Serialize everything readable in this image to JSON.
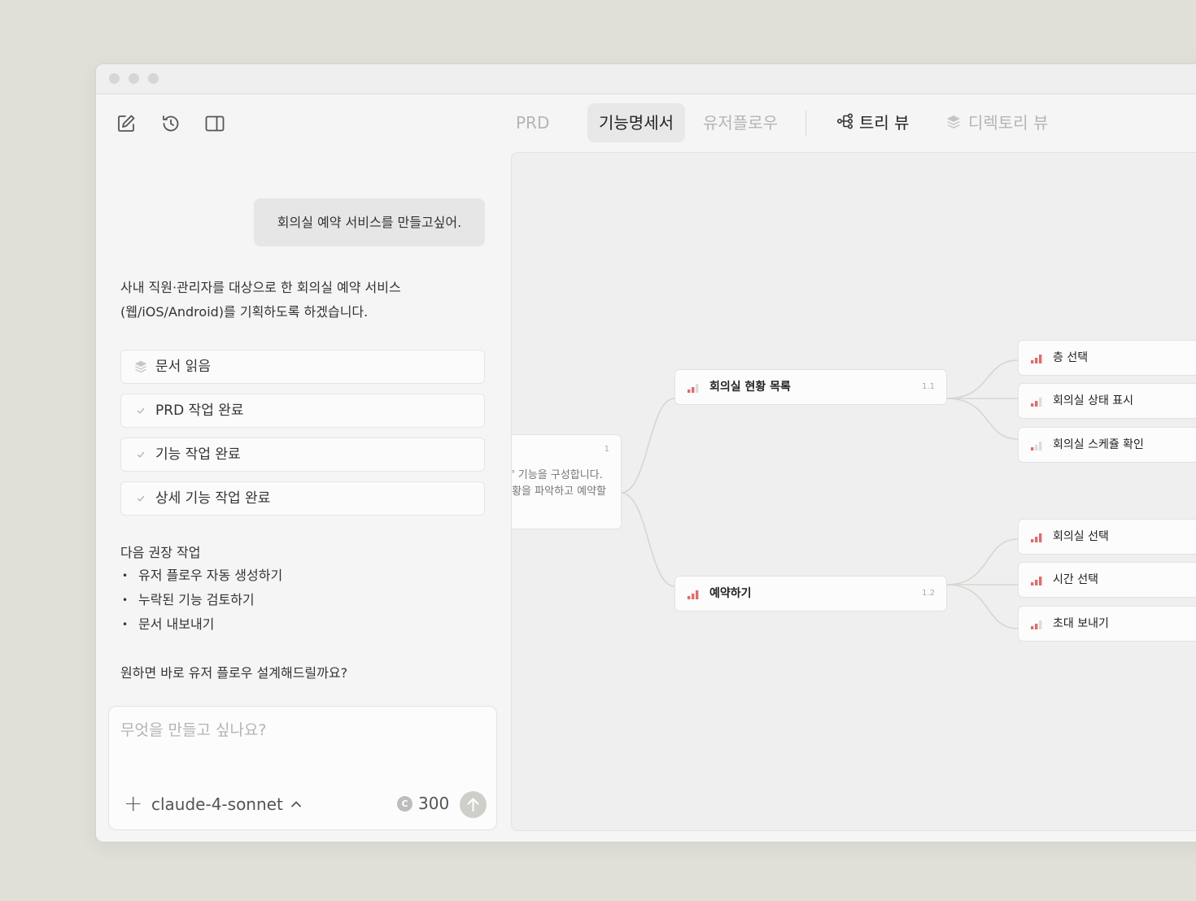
{
  "toolbar": {
    "icons": [
      "new-document-icon",
      "history-icon",
      "sidebar-toggle-icon"
    ]
  },
  "tabs": [
    {
      "label": "PRD",
      "active": false
    },
    {
      "label": "기능명세서",
      "active": true
    },
    {
      "label": "유저플로우",
      "active": false
    }
  ],
  "views": [
    {
      "label": "트리 뷰",
      "icon": "tree-icon",
      "active": true
    },
    {
      "label": "디렉토리 뷰",
      "icon": "layers-icon",
      "active": false
    }
  ],
  "chat": {
    "user_message": "회의실 예약 서비스를 만들고싶어.",
    "assistant_intro_line1": "사내 직원·관리자를 대상으로 한 회의실 예약 서비스",
    "assistant_intro_line2": "(웹/iOS/Android)를 기획하도록 하겠습니다.",
    "tasks": [
      {
        "label": "문서 읽음",
        "icon": "layers-icon"
      },
      {
        "label": "PRD 작업 완료",
        "icon": "check-icon"
      },
      {
        "label": "기능 작업 완료",
        "icon": "check-icon"
      },
      {
        "label": "상세 기능 작업 완료",
        "icon": "check-icon"
      }
    ],
    "recommendations_title": "다음 권장 작업",
    "recommendations": [
      "유저 플로우 자동 생성하기",
      "누락된 기능 검토하기",
      "문서 내보내기"
    ],
    "follow_up": "원하면 바로 유저 플로우 설계해드릴까요?"
  },
  "composer": {
    "placeholder": "무엇을 만들고 싶나요?",
    "model": "claude-4-sonnet",
    "credits": "300"
  },
  "tree": {
    "root": {
      "number": "1",
      "desc_line1": "' 기능을 구성합니다.",
      "desc_line2": "황을 파악하고 예약할"
    },
    "nodes": [
      {
        "label": "회의실 현황 목록",
        "number": "1.1",
        "priority": 2
      },
      {
        "label": "예약하기",
        "number": "1.2",
        "priority": 3
      }
    ],
    "leaves": [
      {
        "label": "층 선택",
        "priority": 3
      },
      {
        "label": "회의실 상태 표시",
        "priority": 2
      },
      {
        "label": "회의실 스케쥴 확인",
        "priority": 1
      },
      {
        "label": "회의실 선택",
        "priority": 3
      },
      {
        "label": "시간 선택",
        "priority": 3
      },
      {
        "label": "초대 보내기",
        "priority": 2
      }
    ],
    "priority_color": "#e06b6b",
    "priority_off_color": "#dcdcdc",
    "connector_color": "#d6d6d0"
  }
}
